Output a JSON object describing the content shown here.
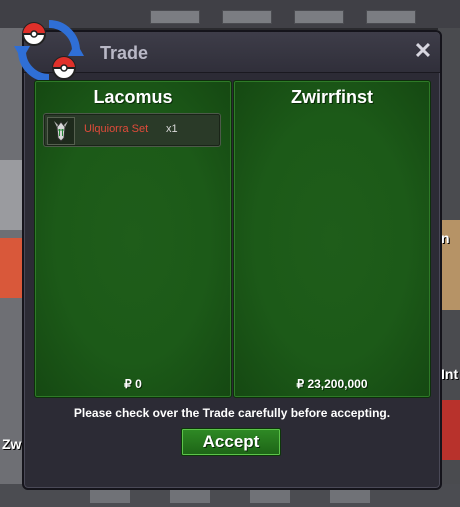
{
  "window": {
    "title": "Trade",
    "close_symbol": "✕",
    "logo_icon": "pokeball-arrows-icon"
  },
  "left_panel": {
    "player_name": "Lacomus",
    "items": [
      {
        "name": "Ulquiorra Set",
        "quantity": "x1",
        "icon": "ulquiorra-mask-icon"
      }
    ],
    "money": "₽ 0"
  },
  "right_panel": {
    "player_name": "Zwirrfinst",
    "items": [],
    "money": "₽ 23,200,000"
  },
  "notice": "Please check over the Trade carefully before accepting.",
  "accept_label": "Accept",
  "background_labels": {
    "left_name_fragment": "Zw",
    "right_name_fragment": "Int",
    "right_top_fragment": "n"
  },
  "colors": {
    "panel_green": "#1c5a18",
    "accept_green": "#2f8a25",
    "item_name_red": "#e04b3a",
    "window_bg": "#2c2b35"
  }
}
